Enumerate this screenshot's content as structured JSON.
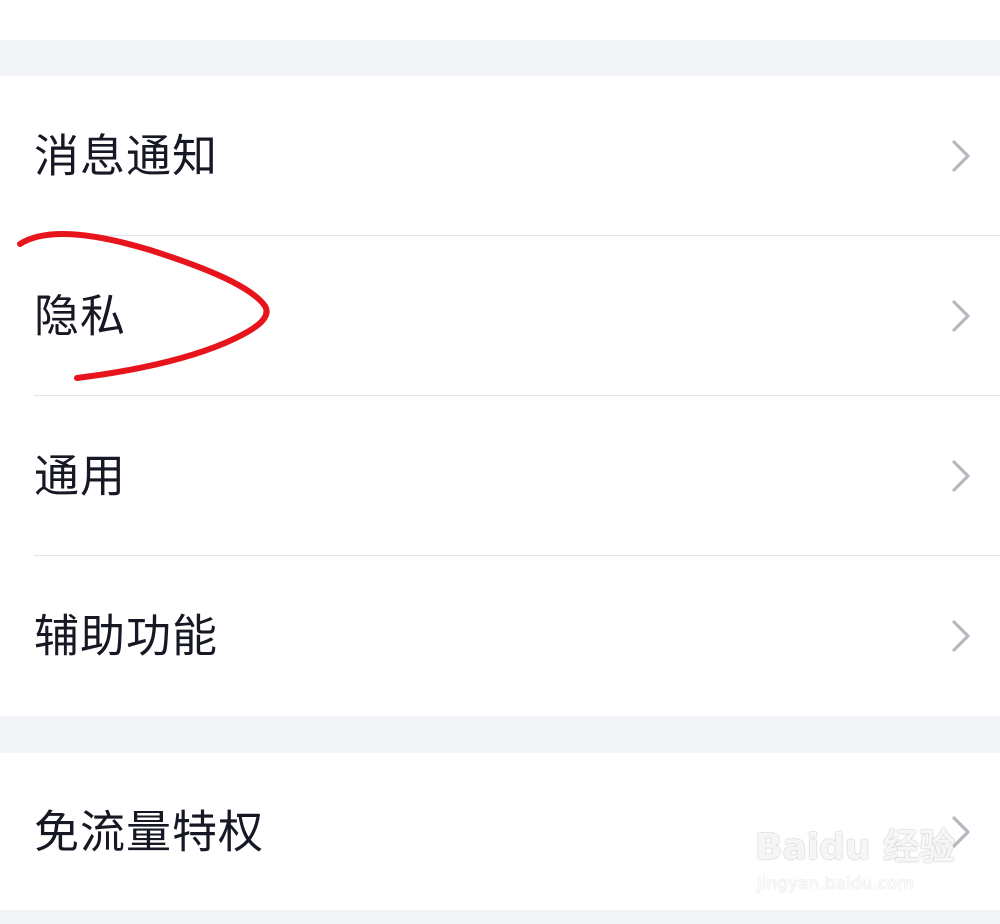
{
  "settings_group_1": [
    {
      "label": "消息通知",
      "icon": "chevron-right-icon"
    },
    {
      "label": "隐私",
      "icon": "chevron-right-icon"
    },
    {
      "label": "通用",
      "icon": "chevron-right-icon"
    },
    {
      "label": "辅助功能",
      "icon": "chevron-right-icon"
    }
  ],
  "settings_group_2": [
    {
      "label": "免流量特权",
      "icon": "chevron-right-icon"
    }
  ],
  "annotation": {
    "color": "#e8141c",
    "target": "隐私"
  },
  "watermark": {
    "logo": "Baidu 经验",
    "url": "jingyan.baidu.com"
  },
  "colors": {
    "background": "#f3f4f8",
    "row": "#ffffff",
    "text": "#161823",
    "chevron": "#b7b8bf",
    "divider": "#e3e4e8"
  }
}
